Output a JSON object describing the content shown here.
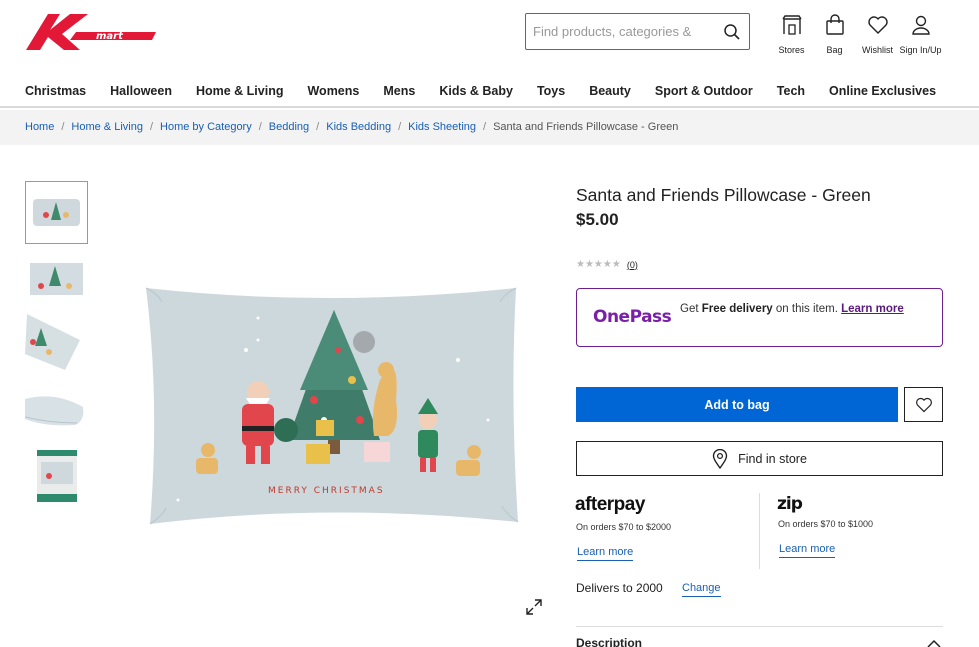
{
  "brand": {
    "name": "Kmart",
    "logo_text": "mart",
    "color": "#e31837"
  },
  "search": {
    "placeholder": "Find products, categories &"
  },
  "header_icons": [
    {
      "icon": "store-icon",
      "label": "Stores"
    },
    {
      "icon": "bag-icon",
      "label": "Bag"
    },
    {
      "icon": "heart-icon",
      "label": "Wishlist"
    },
    {
      "icon": "user-icon",
      "label": "Sign In/Up"
    }
  ],
  "nav": [
    "Christmas",
    "Halloween",
    "Home & Living",
    "Womens",
    "Mens",
    "Kids & Baby",
    "Toys",
    "Beauty",
    "Sport & Outdoor",
    "Tech",
    "Online Exclusives"
  ],
  "breadcrumb": [
    "Home",
    "Home & Living",
    "Home by Category",
    "Bedding",
    "Kids Bedding",
    "Kids Sheeting"
  ],
  "breadcrumb_current": "Santa and Friends Pillowcase - Green",
  "product": {
    "title": "Santa and Friends Pillowcase - Green",
    "price": "$5.00",
    "stars": "★★★★★",
    "rating_count": "(0)",
    "image_text": "MERRY CHRISTMAS"
  },
  "onepass": {
    "logo": "OnePass",
    "text_pre": "Get ",
    "text_bold": "Free delivery",
    "text_post": " on this item. ",
    "learn": "Learn more",
    "color": "#6d1f8e"
  },
  "actions": {
    "add_to_bag": "Add to bag",
    "find_in_store": "Find in store",
    "accent": "#0066d6"
  },
  "afterpay": {
    "logo": "afterpay",
    "sub": "On orders $70 to $2000",
    "learn": "Learn more"
  },
  "zip": {
    "logo": "zip",
    "sub": "On orders $70 to $1000",
    "learn": "Learn more"
  },
  "delivery": {
    "text": "Delivers to 2000",
    "change": "Change"
  },
  "description": {
    "label": "Description"
  }
}
